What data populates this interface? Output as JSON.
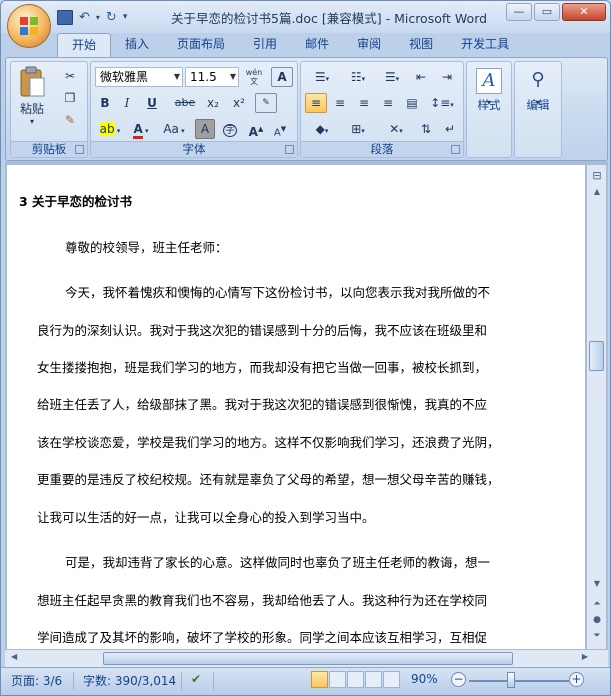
{
  "window": {
    "title": "关于早恋的检讨书5篇.doc [兼容模式] - Microsoft Word",
    "controls": {
      "minimize": "—",
      "restore": "▭",
      "close": "✕"
    }
  },
  "qat": {
    "save_icon": "save-icon",
    "undo_icon": "undo-icon",
    "redo_icon": "redo-icon",
    "customize": "▾"
  },
  "tabs": [
    "开始",
    "插入",
    "页面布局",
    "引用",
    "邮件",
    "审阅",
    "视图",
    "开发工具"
  ],
  "ribbon": {
    "clipboard": {
      "label": "剪贴板",
      "paste": "粘贴",
      "paste_arrow": "▾"
    },
    "font": {
      "label": "字体",
      "font_name": "微软雅黑",
      "font_size": "11.5",
      "bold": "B",
      "italic": "I",
      "underline": "U",
      "strike": "abe",
      "subscript": "x₂",
      "superscript": "x²",
      "highlight": "ab",
      "font_color": "A",
      "change_case": "Aa",
      "char_shade": "A",
      "enclose": "字",
      "grow": "A",
      "shrink": "A",
      "pinyin": "wén",
      "border": "A"
    },
    "paragraph": {
      "label": "段落"
    },
    "styles": {
      "label": "样式"
    },
    "editing": {
      "label": "编辑"
    }
  },
  "document": {
    "lines": [
      "3 关于早恋的检讨书",
      "尊敬的校领导，班主任老师：",
      "今天，我怀着愧疚和懊悔的心情写下这份检讨书，以向您表示我对我所做的不",
      "良行为的深刻认识。我对于我这次犯的错误感到十分的后悔，我不应该在班级里和",
      "女生搂搂抱抱，班是我们学习的地方，而我却没有把它当做一回事，被校长抓到，",
      "给班主任丢了人，给级部抹了黑。我对于我这次犯的错误感到很惭愧，我真的不应",
      "该在学校谈恋爱，学校是我们学习的地方。这样不仅影响我们学习，还浪费了光阴，",
      "更重要的是违反了校纪校规。还有就是辜负了父母的希望，想一想父母辛苦的赚钱，",
      "让我可以生活的好一点，让我可以全身心的投入到学习当中。",
      "可是，我却违背了家长的心意。这样做同时也辜负了班主任老师的教诲，想一",
      "想班主任起早贪黑的教育我们也不容易，我却给他丢了人。我这种行为还在学校同",
      "学间造成了及其坏的影响，破坏了学校的形象。同学之间本应该互相学习，互相促"
    ]
  },
  "status": {
    "page": "页面: 3/6",
    "words": "字数: 390/3,014",
    "zoom": "90%",
    "zoom_fraction": 0.9
  }
}
